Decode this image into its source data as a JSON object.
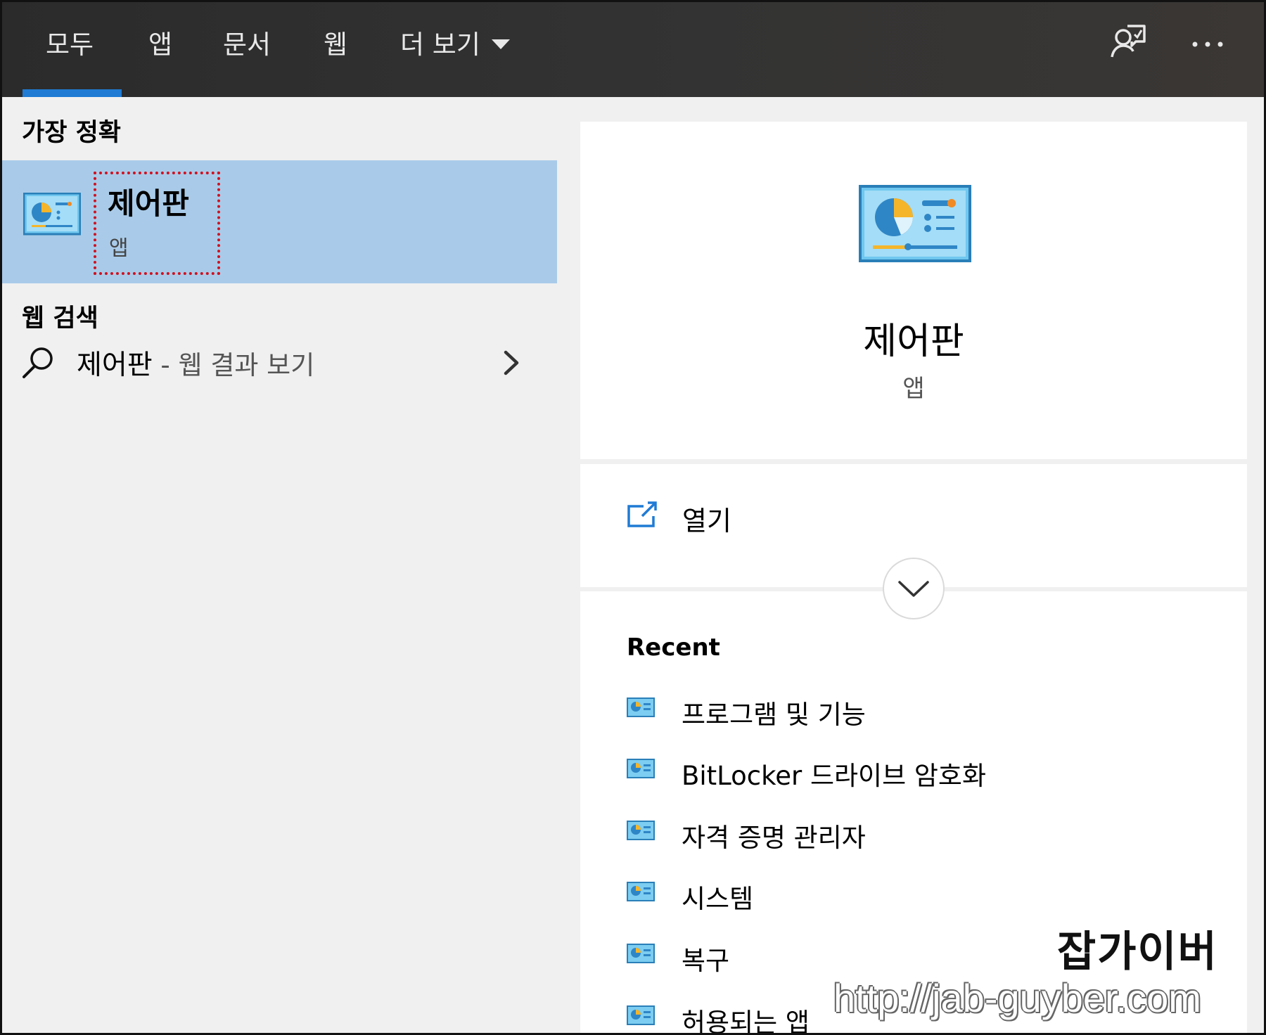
{
  "tabs": [
    {
      "label": "모두",
      "active": true
    },
    {
      "label": "앱"
    },
    {
      "label": "문서"
    },
    {
      "label": "웹"
    },
    {
      "label": "더 보기"
    }
  ],
  "header_icons": [
    "feedback-icon",
    "more-options-icon"
  ],
  "left": {
    "best_match_title": "가장 정확",
    "best_match": {
      "name": "제어판",
      "type": "앱",
      "icon": "control-panel-icon"
    },
    "web_search_title": "웹 검색",
    "web_search": {
      "query": "제어판",
      "suffix": " - 웹 결과 보기",
      "icon": "search-icon"
    }
  },
  "detail": {
    "name": "제어판",
    "type": "앱",
    "icon": "control-panel-icon",
    "open_label": "열기",
    "recent_title": "Recent",
    "recent_items": [
      {
        "label": "프로그램 및 기능"
      },
      {
        "label": "BitLocker 드라이브 암호화"
      },
      {
        "label": "자격 증명 관리자"
      },
      {
        "label": "시스템"
      },
      {
        "label": "복구"
      },
      {
        "label": "허용되는 앱"
      }
    ]
  },
  "watermark": {
    "name": "잡가이버",
    "url": "http://jab-guyber.com"
  },
  "colors": {
    "topbar": "#2b2b2b",
    "accent": "#1f7bd4",
    "selected": "#a9cbe9",
    "left_bg": "#f0f0f0",
    "highlight_box": "#d0101f"
  }
}
